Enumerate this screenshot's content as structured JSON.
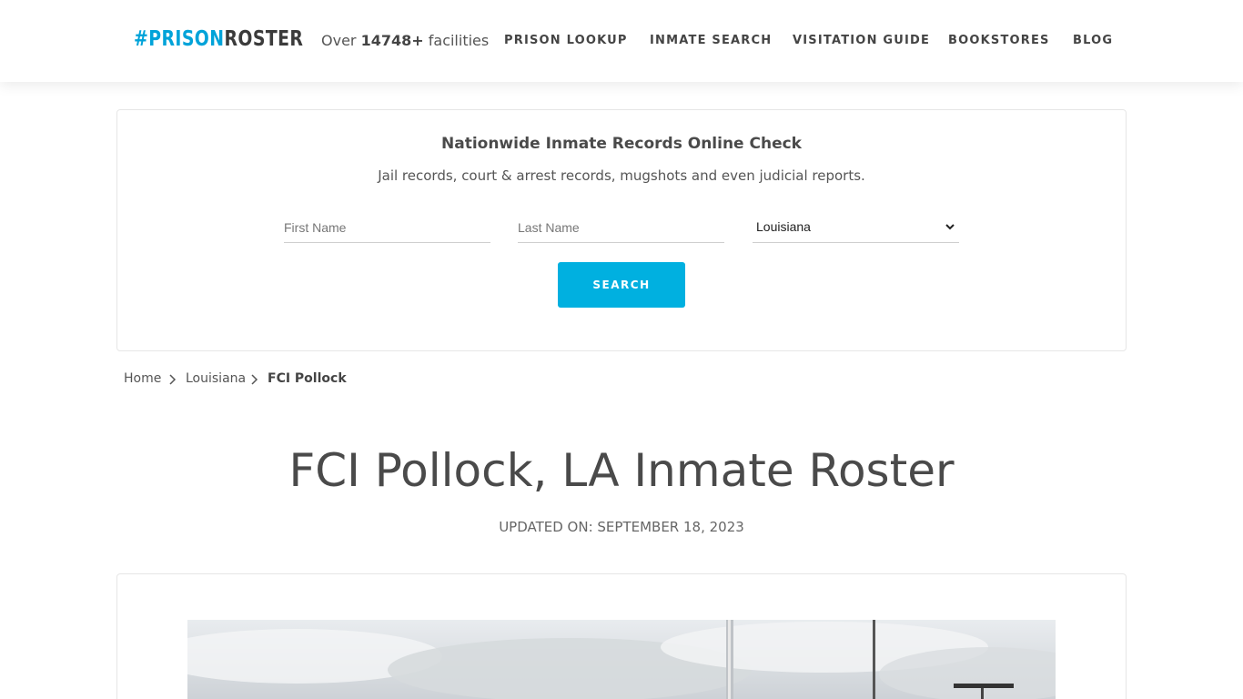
{
  "header": {
    "logo": {
      "hash": "#",
      "prison": "PRISON",
      "roster": "ROSTER"
    },
    "facility_count": {
      "prefix": "Over",
      "count": "14748+",
      "suffix": "facilities"
    },
    "nav": [
      "PRISON LOOKUP",
      "INMATE SEARCH",
      "VISITATION GUIDE",
      "BOOKSTORES",
      "BLOG"
    ]
  },
  "search": {
    "title": "Nationwide Inmate Records Online Check",
    "subtitle": "Jail records, court & arrest records, mugshots and even judicial reports.",
    "first_name_placeholder": "First Name",
    "last_name_placeholder": "Last Name",
    "state_selected": "Louisiana",
    "button_label": "SEARCH"
  },
  "breadcrumb": {
    "home": "Home",
    "state": "Louisiana",
    "current": "FCI Pollock"
  },
  "page": {
    "title": "FCI Pollock, LA Inmate Roster",
    "updated": "UPDATED ON: SEPTEMBER 18, 2023"
  },
  "colors": {
    "accent": "#00b0e0",
    "logo_blue": "#00a3d9",
    "text": "#4a4a4a"
  }
}
